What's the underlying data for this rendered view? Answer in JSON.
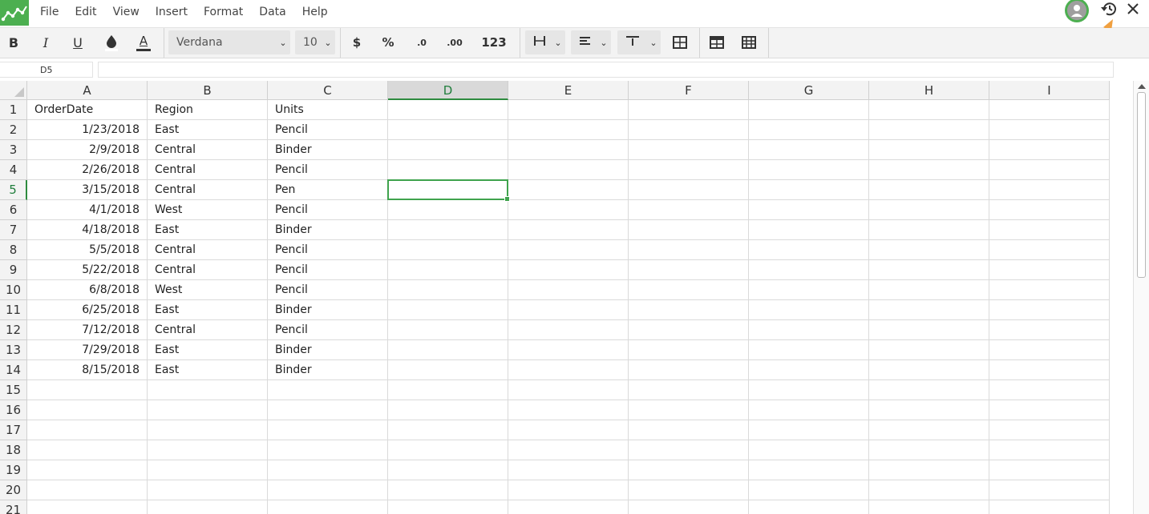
{
  "menu": {
    "items": [
      "File",
      "Edit",
      "View",
      "Insert",
      "Format",
      "Data",
      "Help"
    ]
  },
  "toolbar": {
    "bold": "B",
    "italic": "I",
    "underline": "U",
    "text_color_glyph": "A",
    "font": "Verdana",
    "font_size": "10",
    "currency": "$",
    "percent": "%",
    "decrease_decimals": ".0",
    "increase_decimals": ".00",
    "number_format": "123"
  },
  "formula_bar": {
    "cell_ref": "D5",
    "value": ""
  },
  "sheet": {
    "columns": [
      "A",
      "B",
      "C",
      "D",
      "E",
      "F",
      "G",
      "H",
      "I"
    ],
    "active_column": "D",
    "rows": [
      "1",
      "2",
      "3",
      "4",
      "5",
      "6",
      "7",
      "8",
      "9",
      "10",
      "11",
      "12",
      "13",
      "14",
      "15",
      "16",
      "17",
      "18",
      "19",
      "20",
      "21"
    ],
    "active_row": "5",
    "data": [
      [
        "OrderDate",
        "Region",
        "Units"
      ],
      [
        "1/23/2018",
        "East",
        "Pencil"
      ],
      [
        "2/9/2018",
        "Central",
        "Binder"
      ],
      [
        "2/26/2018",
        "Central",
        "Pencil"
      ],
      [
        "3/15/2018",
        "Central",
        "Pen"
      ],
      [
        "4/1/2018",
        "West",
        "Pencil"
      ],
      [
        "4/18/2018",
        "East",
        "Binder"
      ],
      [
        "5/5/2018",
        "Central",
        "Pencil"
      ],
      [
        "5/22/2018",
        "Central",
        "Pencil"
      ],
      [
        "6/8/2018",
        "West",
        "Pencil"
      ],
      [
        "6/25/2018",
        "East",
        "Binder"
      ],
      [
        "7/12/2018",
        "Central",
        "Pencil"
      ],
      [
        "7/29/2018",
        "East",
        "Binder"
      ],
      [
        "8/15/2018",
        "East",
        "Binder"
      ]
    ]
  },
  "colors": {
    "accent": "#4caf50",
    "selection": "#3fa34d",
    "pointer_arrow": "#f0a040"
  }
}
